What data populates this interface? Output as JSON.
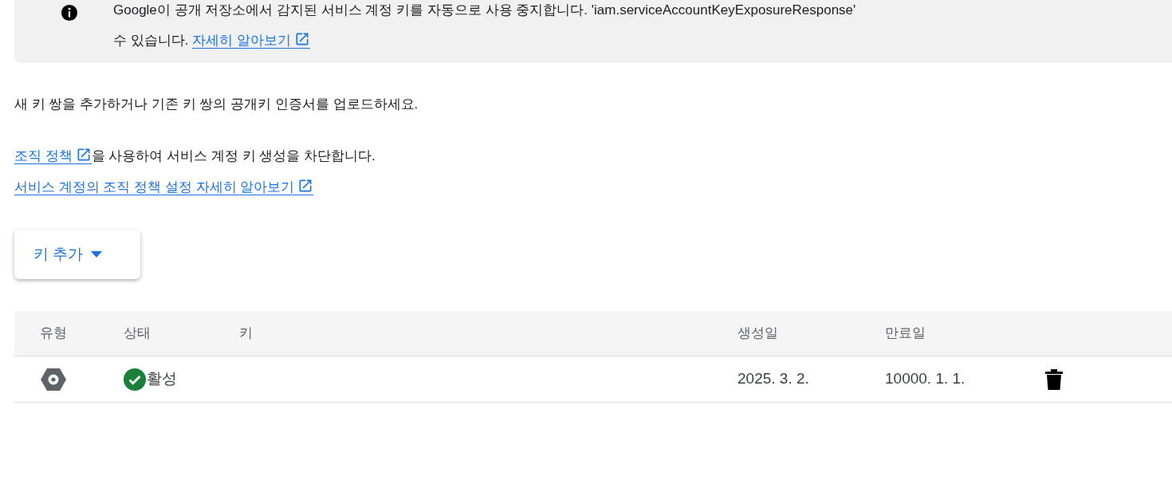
{
  "banner": {
    "lines": [
      "Google이 공개 저장소에서 감지된 서비스 계정 키를 자동으로 사용 중지합니다. 'iam.serviceAccountKeyExposureResponse'",
      "수 있습니다."
    ],
    "link": "자세히 알아보기"
  },
  "intro": "새 키 쌍을 추가하거나 기존 키 쌍의 공개키 인증서를 업로드하세요.",
  "policy": {
    "link": "조직 정책",
    "text": "을 사용하여 서비스 계정 키 생성을 차단합니다.",
    "learn_more": "서비스 계정의 조직 정책 설정 자세히 알아보기"
  },
  "add_key_button": "키 추가",
  "table": {
    "columns": [
      "유형",
      "상태",
      "키",
      "생성일",
      "만료일"
    ],
    "rows": [
      {
        "status": {
          "kind": "active",
          "label": "활성"
        },
        "created": "2025. 3. 2.",
        "expires": "10000. 1. 1."
      }
    ]
  }
}
